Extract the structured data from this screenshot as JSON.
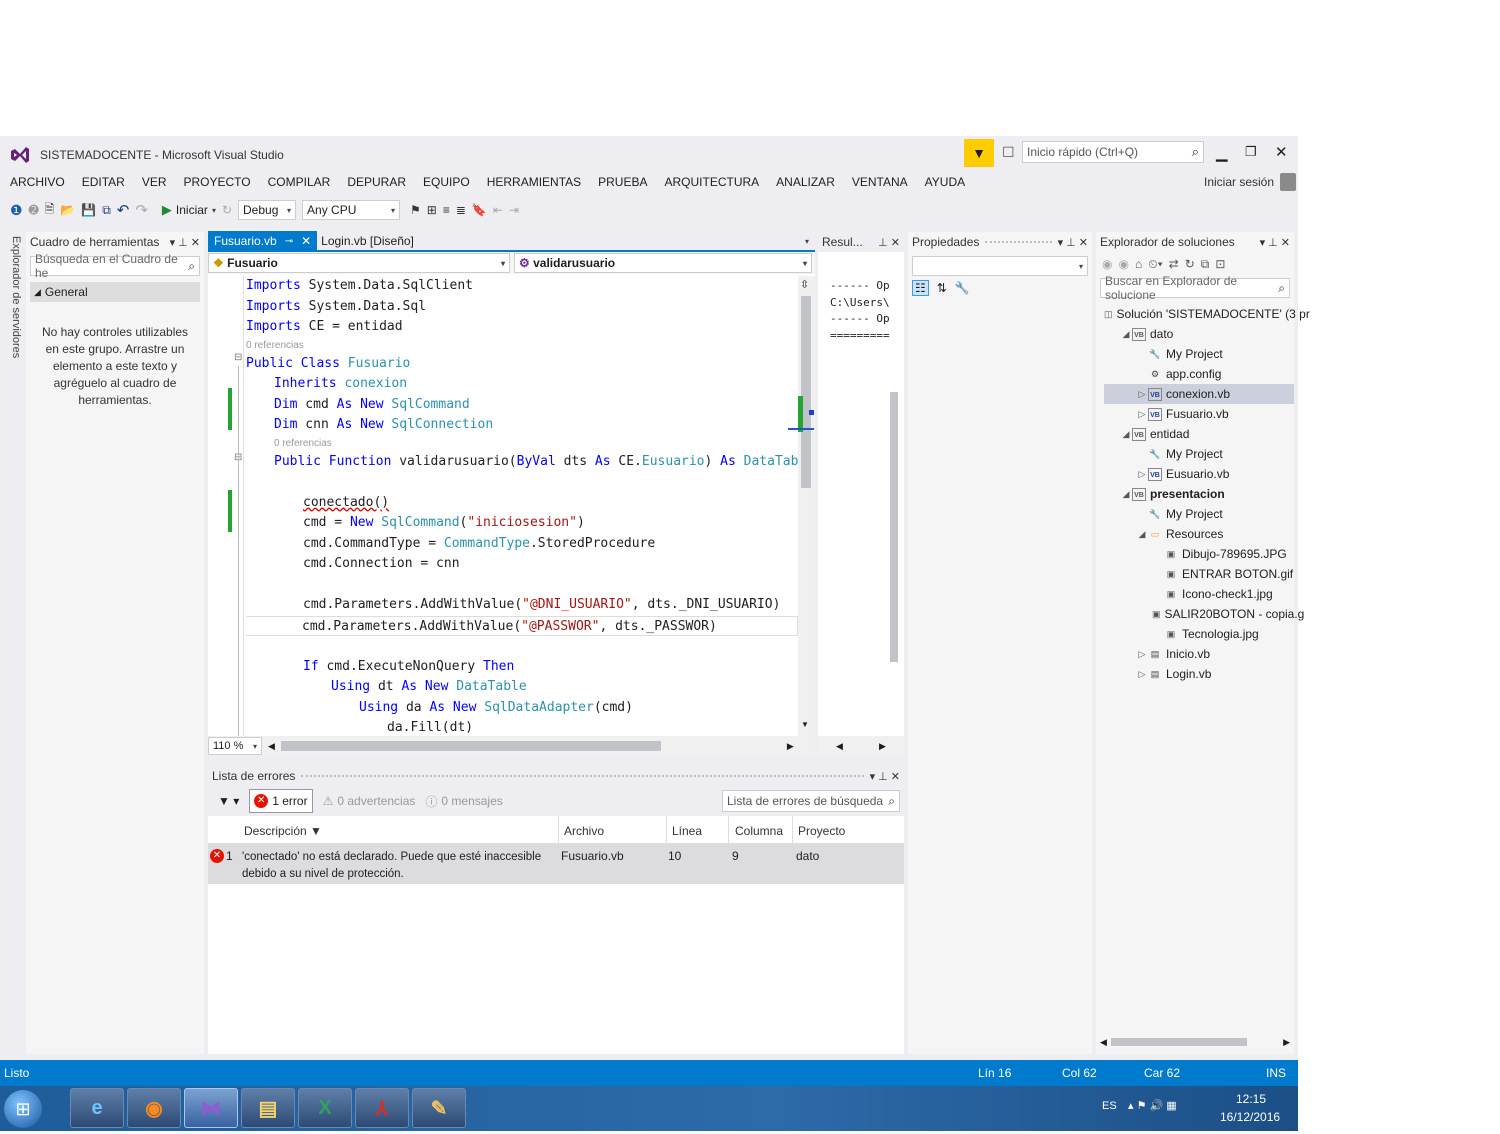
{
  "window": {
    "title": "SISTEMADOCENTE - Microsoft Visual Studio",
    "quick_launch_placeholder": "Inicio rápido (Ctrl+Q)",
    "sign_in": "Iniciar sesión"
  },
  "menu": [
    "ARCHIVO",
    "EDITAR",
    "VER",
    "PROYECTO",
    "COMPILAR",
    "DEPURAR",
    "EQUIPO",
    "HERRAMIENTAS",
    "PRUEBA",
    "ARQUITECTURA",
    "ANALIZAR",
    "VENTANA",
    "AYUDA"
  ],
  "toolbar": {
    "start_label": "Iniciar",
    "config": "Debug",
    "platform": "Any CPU"
  },
  "server_explorer_tab": "Explorador de servidores",
  "toolbox": {
    "title": "Cuadro de herramientas",
    "search_placeholder": "Búsqueda en el Cuadro de he",
    "group": "General",
    "empty_message": "No hay controles utilizables en este grupo. Arrastre un elemento a este texto y agréguelo al cuadro de herramientas."
  },
  "editor": {
    "tabs": [
      {
        "label": "Fusuario.vb",
        "active": true
      },
      {
        "label": "Login.vb [Diseño]",
        "active": false
      }
    ],
    "class_dropdown": "Fusuario",
    "member_dropdown": "validarusuario",
    "zoom": "110 %",
    "references_label": "0 referencias",
    "code": {
      "l1": [
        "Imports",
        " System.Data.SqlClient"
      ],
      "l2": [
        "Imports",
        " System.Data.Sql"
      ],
      "l3": [
        "Imports",
        " CE = entidad"
      ],
      "l4": [
        "Public Class",
        " Fusuario"
      ],
      "l5": [
        "Inherits",
        " conexion"
      ],
      "l6": [
        "Dim",
        " cmd ",
        "As New",
        " SqlCommand"
      ],
      "l7": [
        "Dim",
        " cnn ",
        "As New",
        " SqlConnection"
      ],
      "l8": [
        "Public Function",
        " validarusuario(",
        "ByVal",
        " dts ",
        "As",
        " CE.",
        "Eusuario",
        ") ",
        "As",
        " DataTable"
      ],
      "l9": "conectado()",
      "l10": [
        "cmd = ",
        "New",
        " SqlCommand",
        "(",
        "\"iniciosesion\"",
        ")"
      ],
      "l11": [
        "cmd.CommandType = ",
        "CommandType",
        ".StoredProcedure"
      ],
      "l12": "cmd.Connection = cnn",
      "l13": [
        "cmd.Parameters.AddWithValue(",
        "\"@DNI_USUARIO\"",
        ", dts._DNI_USUARIO)"
      ],
      "l14": [
        "cmd.Parameters.AddWithValue(",
        "\"@PASSWOR\"",
        ", dts._PASSWOR)"
      ],
      "l15": [
        "If",
        " cmd.ExecuteNonQuery ",
        "Then"
      ],
      "l16": [
        "Using",
        " dt ",
        "As New",
        " DataTable"
      ],
      "l17": [
        "Using",
        " da ",
        "As New",
        " SqlDataAdapter",
        "(cmd)"
      ],
      "l18": "da.Fill(dt)"
    }
  },
  "results_panel": {
    "title": "Resul...",
    "lines": [
      "------ Op",
      "C:\\Users\\",
      "------ Op",
      "========="
    ]
  },
  "properties": {
    "title": "Propiedades"
  },
  "solution_explorer": {
    "title": "Explorador de soluciones",
    "search_placeholder": "Buscar en Explorador de solucione",
    "items": [
      {
        "label": "Solución 'SISTEMADOCENTE' (3 pr",
        "indent": 0,
        "twisty": "",
        "icon": "solution"
      },
      {
        "label": "dato",
        "indent": 1,
        "twisty": "◢",
        "icon": "vbproj"
      },
      {
        "label": "My Project",
        "indent": 2,
        "twisty": "",
        "icon": "wrench"
      },
      {
        "label": "app.config",
        "indent": 2,
        "twisty": "",
        "icon": "config"
      },
      {
        "label": "conexion.vb",
        "indent": 2,
        "twisty": "▷",
        "icon": "vb",
        "selected": true
      },
      {
        "label": "Fusuario.vb",
        "indent": 2,
        "twisty": "▷",
        "icon": "vb"
      },
      {
        "label": "entidad",
        "indent": 1,
        "twisty": "◢",
        "icon": "vbproj"
      },
      {
        "label": "My Project",
        "indent": 2,
        "twisty": "",
        "icon": "wrench"
      },
      {
        "label": "Eusuario.vb",
        "indent": 2,
        "twisty": "▷",
        "icon": "vb"
      },
      {
        "label": "presentacion",
        "indent": 1,
        "twisty": "◢",
        "icon": "vbproj",
        "bold": true
      },
      {
        "label": "My Project",
        "indent": 2,
        "twisty": "",
        "icon": "wrench"
      },
      {
        "label": "Resources",
        "indent": 2,
        "twisty": "◢",
        "icon": "folder"
      },
      {
        "label": "Dibujo-789695.JPG",
        "indent": 3,
        "twisty": "",
        "icon": "image"
      },
      {
        "label": "ENTRAR BOTON.gif",
        "indent": 3,
        "twisty": "",
        "icon": "image"
      },
      {
        "label": "Icono-check1.jpg",
        "indent": 3,
        "twisty": "",
        "icon": "image"
      },
      {
        "label": "SALIR20BOTON - copia.g",
        "indent": 3,
        "twisty": "",
        "icon": "image"
      },
      {
        "label": "Tecnologia.jpg",
        "indent": 3,
        "twisty": "",
        "icon": "image"
      },
      {
        "label": "Inicio.vb",
        "indent": 2,
        "twisty": "▷",
        "icon": "form"
      },
      {
        "label": "Login.vb",
        "indent": 2,
        "twisty": "▷",
        "icon": "form"
      }
    ]
  },
  "error_list": {
    "title": "Lista de errores",
    "errors_btn": "1 error",
    "warnings_btn": "0 advertencias",
    "messages_btn": "0 mensajes",
    "search_placeholder": "Lista de errores de búsqueda",
    "columns": [
      "Descripción",
      "Archivo",
      "Línea",
      "Columna",
      "Proyecto"
    ],
    "rows": [
      {
        "num": "1",
        "description": "'conectado' no está declarado. Puede que esté inaccesible debido a su nivel de protección.",
        "file": "Fusuario.vb",
        "line": "10",
        "column": "9",
        "project": "dato"
      }
    ]
  },
  "status_bar": {
    "text": "Listo",
    "line": "Lín 16",
    "col": "Col 62",
    "car": "Car 62",
    "mode": "INS"
  },
  "taskbar": {
    "lang": "ES",
    "time": "12:15",
    "date": "16/12/2016"
  },
  "colors": {
    "accent": "#007acc",
    "statusbar": "#007acc",
    "taskbar": "#1c4f86",
    "editor_tab": "#007acc"
  }
}
